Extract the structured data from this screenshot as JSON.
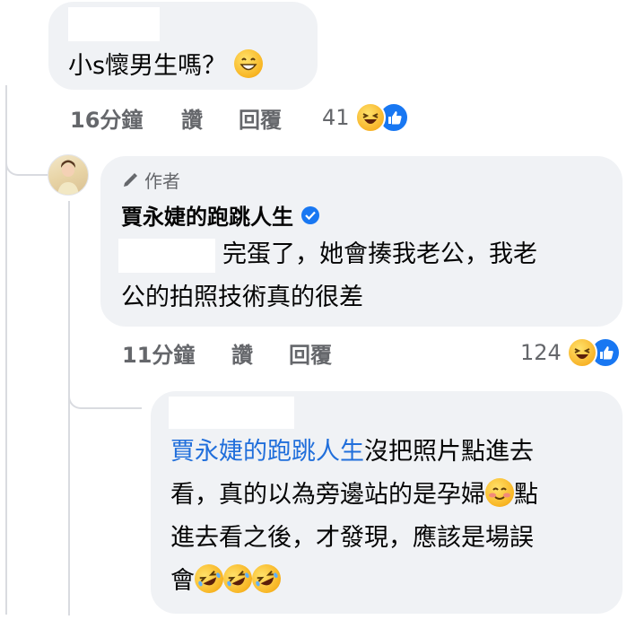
{
  "comment1": {
    "text": "小s懷男生嗎？",
    "time": "16分鐘",
    "like_label": "讚",
    "reply_label": "回覆",
    "reaction_count": "41"
  },
  "reply1": {
    "author_badge": "作者",
    "author_name": "賈永婕的跑跳人生",
    "text_line1": "完蛋了，她會揍我老公，我老",
    "text_line2": "公的拍照技術真的很差",
    "time": "11分鐘",
    "like_label": "讚",
    "reply_label": "回覆",
    "reaction_count": "124"
  },
  "reply2": {
    "mention": "賈永婕的跑跳人生",
    "text_after_mention": "沒把照片點進去",
    "text_line2a": "看，真的以為旁邊站的是孕婦",
    "text_line2b": "點",
    "text_line3": "進去看之後，才發現，應該是場誤",
    "text_line4": "會"
  },
  "colors": {
    "bubble": "#f0f2f5",
    "meta_text": "#65676b",
    "mention": "#216fdb",
    "verified": "#1877f2",
    "like_blue": "#1877f2"
  },
  "icons": [
    "grinning-emoji-icon",
    "haha-reaction-icon",
    "like-reaction-icon",
    "pencil-icon",
    "verified-badge-icon",
    "smiling-blush-emoji-icon",
    "rofl-emoji-icon"
  ]
}
